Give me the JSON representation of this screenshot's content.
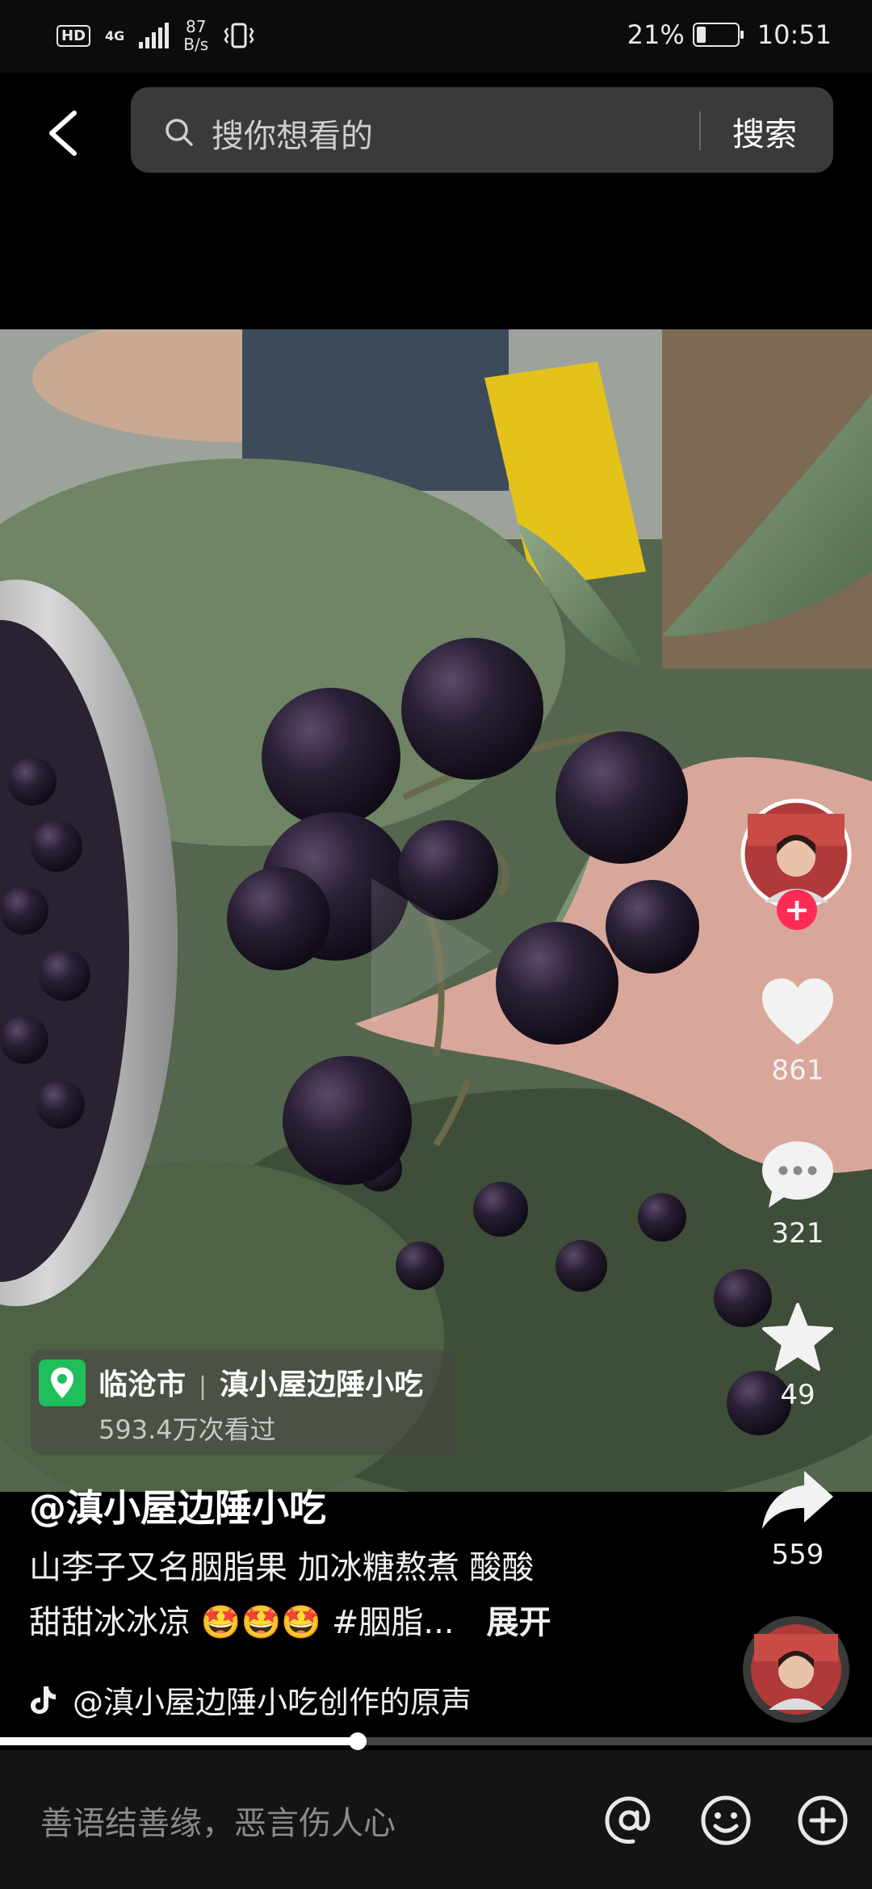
{
  "status_bar": {
    "hd": "HD",
    "network": "4G",
    "speed_value": "87",
    "speed_unit": "B/s",
    "battery": "21%",
    "time": "10:51"
  },
  "search": {
    "placeholder": "搜你想看的",
    "button": "搜索"
  },
  "rail": {
    "likes": "861",
    "comments": "321",
    "favorites": "49",
    "shares": "559"
  },
  "location": {
    "city": "临沧市",
    "place": "滇小屋边陲小吃",
    "views": "593.4万次看过"
  },
  "post": {
    "author": "@滇小屋边陲小吃",
    "caption_line1": "山李子又名胭脂果 加冰糖熬煮 酸酸",
    "caption_line2": "甜甜冰冰凉 🤩🤩🤩 #胭脂...",
    "expand": "展开",
    "music": "@滇小屋边陲小吃创作的原声"
  },
  "progress": 0.41,
  "bottom": {
    "comment_placeholder": "善语结善缘，恶言伤人心"
  },
  "colors": {
    "accent_red": "#fe2c55",
    "location_green": "#1fbf5b"
  }
}
